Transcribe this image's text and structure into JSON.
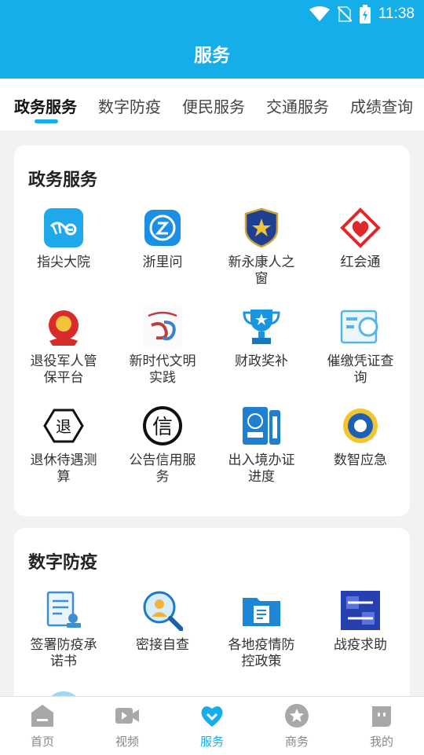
{
  "status_bar": {
    "time": "11:38"
  },
  "header": {
    "title": "服务"
  },
  "tabs": [
    {
      "label": "政务服务",
      "active": true
    },
    {
      "label": "数字防疫",
      "active": false
    },
    {
      "label": "便民服务",
      "active": false
    },
    {
      "label": "交通服务",
      "active": false
    },
    {
      "label": "成绩查询",
      "active": false
    }
  ],
  "sections": [
    {
      "title": "政务服务",
      "items": [
        {
          "label": "指尖大院",
          "icon": "bird-app-icon"
        },
        {
          "label": "浙里问",
          "icon": "chat-app-icon"
        },
        {
          "label": "新永康人之窗",
          "icon": "police-badge-icon"
        },
        {
          "label": "红会通",
          "icon": "red-cross-heart-icon"
        },
        {
          "label": "退役军人管保平台",
          "icon": "national-emblem-icon"
        },
        {
          "label": "新时代文明实践",
          "icon": "civilization-logo-icon"
        },
        {
          "label": "财政奖补",
          "icon": "trophy-icon"
        },
        {
          "label": "催缴凭证查询",
          "icon": "voucher-search-icon"
        },
        {
          "label": "退休待遇测算",
          "icon": "retire-hexagon-icon"
        },
        {
          "label": "公告信用服务",
          "icon": "credit-circle-icon"
        },
        {
          "label": "出入境办证进度",
          "icon": "passport-icon"
        },
        {
          "label": "数智应急",
          "icon": "emergency-emblem-icon"
        }
      ]
    },
    {
      "title": "数字防疫",
      "items": [
        {
          "label": "签署防疫承诺书",
          "icon": "document-stamp-icon"
        },
        {
          "label": "密接自查",
          "icon": "magnifier-person-icon"
        },
        {
          "label": "各地疫情防控政策",
          "icon": "folder-icon"
        },
        {
          "label": "战疫求助",
          "icon": "help-badge-icon"
        }
      ]
    }
  ],
  "bottom_nav": [
    {
      "label": "首页",
      "icon": "home-icon",
      "active": false
    },
    {
      "label": "视频",
      "icon": "video-icon",
      "active": false
    },
    {
      "label": "服务",
      "icon": "heart-service-icon",
      "active": true
    },
    {
      "label": "商务",
      "icon": "star-icon",
      "active": false
    },
    {
      "label": "我的",
      "icon": "profile-icon",
      "active": false
    }
  ],
  "colors": {
    "primary": "#16aee8",
    "background": "#f2f2f2"
  }
}
